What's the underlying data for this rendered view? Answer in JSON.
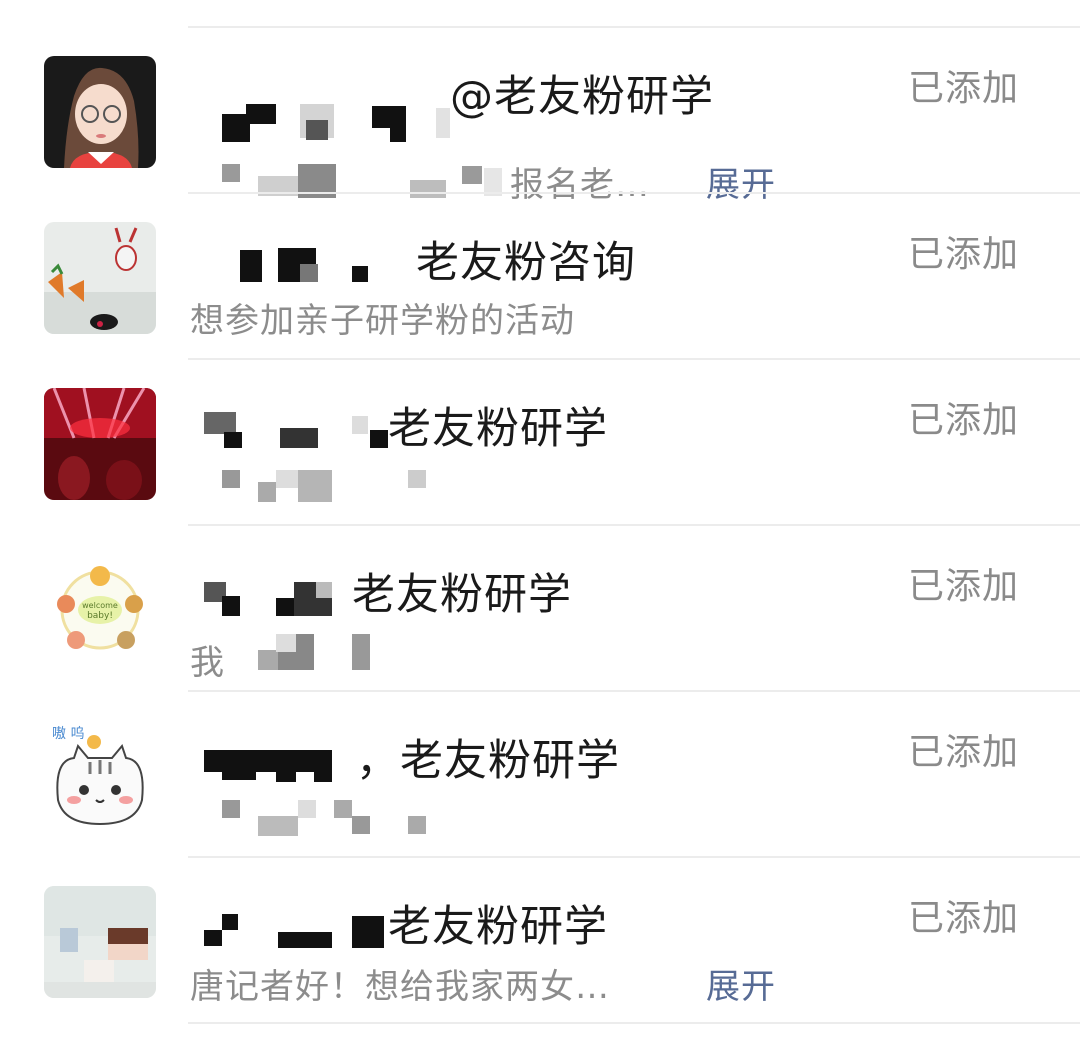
{
  "requests": [
    {
      "name_visible": "@老友粉研学",
      "message": "报名老…",
      "expand_label": "展开",
      "status": "已添加",
      "avatar_icon": "cartoon-girl-avatar"
    },
    {
      "name_visible": "老友粉咨询",
      "message": "想参加亲子研学粉的活动",
      "expand_label": "",
      "status": "已添加",
      "avatar_icon": "rabbit-wall-avatar"
    },
    {
      "name_visible": "老友粉研学",
      "message": "",
      "expand_label": "",
      "status": "已添加",
      "avatar_icon": "red-stage-avatar"
    },
    {
      "name_visible": "老友粉研学",
      "message": "我",
      "expand_label": "",
      "status": "已添加",
      "avatar_icon": "welcome-baby-avatar"
    },
    {
      "name_visible": "，老友粉研学",
      "message": "",
      "expand_label": "",
      "status": "已添加",
      "avatar_icon": "cat-sticker-avatar",
      "avatar_text": "嗷 呜"
    },
    {
      "name_visible": "老友粉研学",
      "message": "唐记者好！想给我家两女…",
      "expand_label": "展开",
      "status": "已添加",
      "avatar_icon": "blurred-photo-avatar"
    }
  ],
  "colors": {
    "status_text": "#8a8a8a",
    "expand_link": "#576b95",
    "divider": "#ececec"
  }
}
